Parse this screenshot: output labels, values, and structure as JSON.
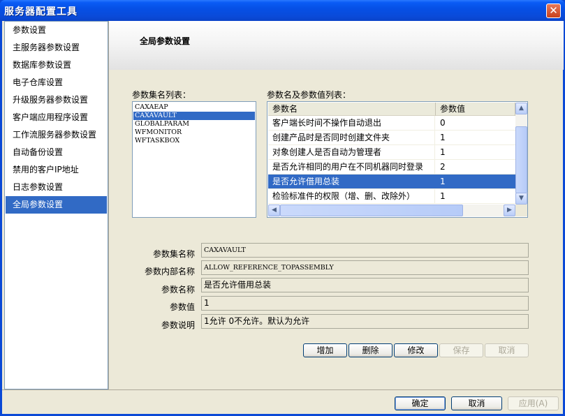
{
  "window": {
    "title": "服务器配置工具",
    "close_symbol": "✕"
  },
  "sidebar": {
    "items": [
      {
        "label": "参数设置"
      },
      {
        "label": "主服务器参数设置"
      },
      {
        "label": "数据库参数设置"
      },
      {
        "label": "电子仓库设置"
      },
      {
        "label": "升级服务器参数设置"
      },
      {
        "label": "客户端应用程序设置"
      },
      {
        "label": "工作流服务器参数设置"
      },
      {
        "label": "自动备份设置"
      },
      {
        "label": "禁用的客户IP地址"
      },
      {
        "label": "日志参数设置"
      },
      {
        "label": "全局参数设置"
      }
    ],
    "selected_index": 10
  },
  "panel": {
    "title": "全局参数设置",
    "set_list_label": "参数集名列表：",
    "param_list_label": "参数名及参数值列表：",
    "param_sets": [
      {
        "label": "CAXAEAP"
      },
      {
        "label": "CAXAVAULT"
      },
      {
        "label": "GLOBALPARAM"
      },
      {
        "label": "WFMONITOR"
      },
      {
        "label": "WFTASKBOX"
      }
    ],
    "selected_set_index": 1,
    "grid": {
      "columns": [
        "参数名",
        "参数值"
      ],
      "rows": [
        {
          "name": "客户端长时间不操作自动退出",
          "value": "0"
        },
        {
          "name": "创建产品时是否同时创建文件夹",
          "value": "1"
        },
        {
          "name": "对象创建人是否自动为管理者",
          "value": "1"
        },
        {
          "name": "是否允许相同的用户在不同机器同时登录",
          "value": "2"
        },
        {
          "name": "是否允许借用总装",
          "value": "1"
        },
        {
          "name": "检验标准件的权限（增、删、改除外）",
          "value": "1"
        }
      ],
      "selected_row_index": 4
    },
    "details": {
      "set_name_label": "参数集名称",
      "set_name_value": "CAXAVAULT",
      "internal_name_label": "参数内部名称",
      "internal_name_value": "ALLOW_REFERENCE_TOPASSEMBLY",
      "param_name_label": "参数名称",
      "param_name_value": "是否允许借用总装",
      "param_value_label": "参数值",
      "param_value_value": "1",
      "desc_label": "参数说明",
      "desc_value": "1允许 0不允许。默认为允许"
    },
    "actions": {
      "add": "增加",
      "delete": "删除",
      "modify": "修改",
      "save": "保存",
      "cancel": "取消"
    }
  },
  "footer": {
    "ok": "确定",
    "cancel": "取消",
    "apply": "应用(A)"
  },
  "colors": {
    "selection": "#316ac5",
    "titlebar": "#0a5cf5",
    "face": "#ece9d8"
  },
  "icons": {
    "up": "▲",
    "down": "▼",
    "left": "◀",
    "right": "▶"
  }
}
